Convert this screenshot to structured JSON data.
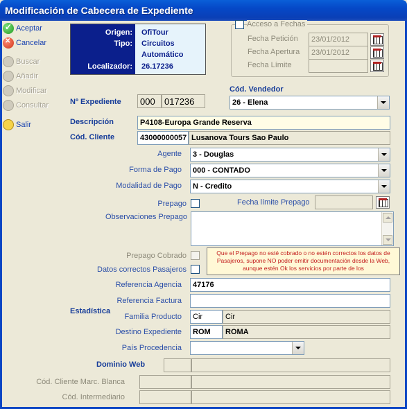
{
  "window": {
    "title": "Modificación de Cabecera de Expediente"
  },
  "toolbar": [
    {
      "label": "Aceptar",
      "icon": "accept-icon",
      "enabled": true
    },
    {
      "label": "Cancelar",
      "icon": "cancel-icon",
      "enabled": true
    },
    {
      "label": "Buscar",
      "icon": "search-icon",
      "enabled": false
    },
    {
      "label": "Añadir",
      "icon": "add-icon",
      "enabled": false
    },
    {
      "label": "Modificar",
      "icon": "edit-icon",
      "enabled": false
    },
    {
      "label": "Consultar",
      "icon": "view-icon",
      "enabled": false
    },
    {
      "label": "Salir",
      "icon": "exit-icon",
      "enabled": true
    }
  ],
  "info": {
    "origen_label": "Origen:",
    "origen": "OfiTour",
    "tipo_label": "Tipo:",
    "tipo": "Circuitos",
    "tipo2": "Automático",
    "localizador_label": "Localizador:",
    "localizador": "26.17236"
  },
  "fechas": {
    "acceso_label": "Acceso a Fechas",
    "peticion_label": "Fecha Petición",
    "peticion": "23/01/2012",
    "apertura_label": "Fecha Apertura",
    "apertura": "23/01/2012",
    "limite_label": "Fecha Límite",
    "limite": ""
  },
  "expediente": {
    "label": "Nº Expediente",
    "part1": "000",
    "part2": "017236"
  },
  "vendedor": {
    "label": "Cód. Vendedor",
    "value": "26 - Elena"
  },
  "descripcion": {
    "label": "Descripción",
    "value": "P4108-Europa Grande Reserva"
  },
  "cliente": {
    "label": "Cód. Cliente",
    "code": "43000000057",
    "name": "Lusanova Tours Sao Paulo"
  },
  "agente": {
    "label": "Agente",
    "value": "3 - Douglas"
  },
  "forma_pago": {
    "label": "Forma de Pago",
    "value": "000 - CONTADO"
  },
  "modalidad_pago": {
    "label": "Modalidad de Pago",
    "value": "N - Credito"
  },
  "prepago": {
    "label": "Prepago",
    "fecha_limite_label": "Fecha límite Prepago",
    "fecha_limite": ""
  },
  "observaciones": {
    "label": "Observaciones Prepago",
    "value": ""
  },
  "prepago_cobrado": {
    "label": "Prepago Cobrado"
  },
  "datos_correctos": {
    "label": "Datos correctos Pasajeros"
  },
  "warning": "Que el Prepago no esté cobrado o no estén correctos los datos de Pasajeros, supone NO poder emitir documentación desde la Web, aunque estén Ok los servicios por parte de los",
  "referencia_agencia": {
    "label": "Referencia Agencia",
    "value": "47176"
  },
  "referencia_factura": {
    "label": "Referencia Factura",
    "value": ""
  },
  "estadistica": {
    "label": "Estadística"
  },
  "familia_producto": {
    "label": "Familia Producto",
    "code": "Cir",
    "name": "Cir"
  },
  "destino_expediente": {
    "label": "Destino Expediente",
    "code": "ROM",
    "name": "ROMA"
  },
  "pais_procedencia": {
    "label": "País Procedencia",
    "value": ""
  },
  "dominio_web": {
    "label": "Dominio Web"
  },
  "cliente_marca_blanca": {
    "label": "Cód. Cliente Marc. Blanca"
  },
  "intermediario": {
    "label": "Cód. Intermediario"
  }
}
